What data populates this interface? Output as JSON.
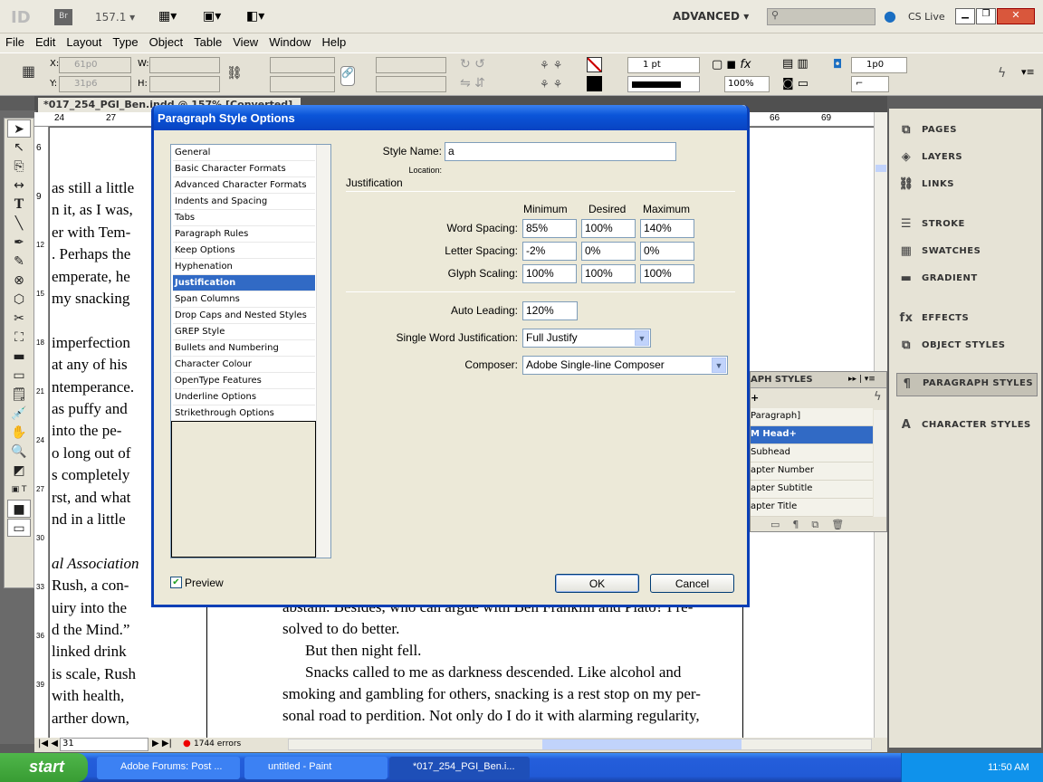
{
  "appbar": {
    "logo": "ID",
    "bridge": "Br",
    "zoom": "157.1",
    "workspace": "ADVANCED",
    "search_placeholder": "",
    "cslive": "CS Live"
  },
  "menu": [
    "File",
    "Edit",
    "Layout",
    "Type",
    "Object",
    "Table",
    "View",
    "Window",
    "Help"
  ],
  "control": {
    "x": "61p0",
    "y": "31p6",
    "w": "",
    "h": "",
    "x_label": "X:",
    "y_label": "Y:",
    "w_label": "W:",
    "h_label": "H:",
    "stroke_weight": "1 pt",
    "opacity": "100%",
    "gap": "1p0"
  },
  "document": {
    "tab_title": "*017_254_PGI_Ben.indd @ 157% [Converted]",
    "ruler_top": [
      "24",
      "27",
      "66",
      "69"
    ],
    "ruler_left": [
      "6",
      "9",
      "12",
      "15",
      "18",
      "21",
      "24",
      "27",
      "30",
      "33",
      "36",
      "39"
    ],
    "left_lines": [
      "as still a little",
      "n it, as I was,",
      "er with Tem-",
      ". Perhaps the",
      "emperate, he",
      "my snacking",
      "",
      "imperfection",
      "at any of his",
      "ntemperance.",
      "as puffy and",
      "into the pe-",
      "o long out of",
      "s completely",
      "rst, and what",
      "nd in a little",
      "",
      "al Association",
      "Rush, a con-",
      "uiry into the",
      "d the Mind.”",
      "linked drink",
      "is scale, Rush",
      "with health,",
      "arther down,"
    ],
    "right_lines": [
      "abstain. Besides, who can argue with Ben Franklin and Plato? I re-",
      "solved to do better.",
      "But then night fell.",
      "Snacks called to me as darkness descended. Like alcohol and",
      "smoking and gambling for others, snacking is a rest stop on my per-",
      "sonal road to perdition. Not only do I do it with alarming regularity,"
    ]
  },
  "status": {
    "page": "31",
    "errors": "1744 errors"
  },
  "right_panel": [
    {
      "label": "PAGES",
      "icon": "pages-icon"
    },
    {
      "label": "LAYERS",
      "icon": "layers-icon"
    },
    {
      "label": "LINKS",
      "icon": "links-icon"
    },
    {
      "label": "STROKE",
      "icon": "stroke-icon"
    },
    {
      "label": "SWATCHES",
      "icon": "swatches-icon"
    },
    {
      "label": "GRADIENT",
      "icon": "gradient-icon"
    },
    {
      "label": "EFFECTS",
      "icon": "fx-icon"
    },
    {
      "label": "OBJECT STYLES",
      "icon": "object-styles-icon"
    },
    {
      "label": "PARAGRAPH STYLES",
      "icon": "paragraph-styles-icon",
      "selected": true
    },
    {
      "label": "CHARACTER STYLES",
      "icon": "character-styles-icon"
    }
  ],
  "para_styles_panel": {
    "title": "APH STYLES",
    "current": "+",
    "items": [
      "Paragraph]",
      "M Head+",
      "Subhead",
      "apter Number",
      "apter Subtitle",
      "apter Title"
    ],
    "selected_index": 1
  },
  "dialog": {
    "title": "Paragraph Style Options",
    "categories": [
      "General",
      "Basic Character Formats",
      "Advanced Character Formats",
      "Indents and Spacing",
      "Tabs",
      "Paragraph Rules",
      "Keep Options",
      "Hyphenation",
      "Justification",
      "Span Columns",
      "Drop Caps and Nested Styles",
      "GREP Style",
      "Bullets and Numbering",
      "Character Colour",
      "OpenType Features",
      "Underline Options",
      "Strikethrough Options"
    ],
    "selected_category": 8,
    "style_name_label": "Style Name:",
    "style_name": "a",
    "location_label": "Location:",
    "section": "Justification",
    "col_headers": [
      "Minimum",
      "Desired",
      "Maximum"
    ],
    "rows": [
      {
        "label": "Word Spacing:",
        "values": [
          "85%",
          "100%",
          "140%"
        ]
      },
      {
        "label": "Letter Spacing:",
        "values": [
          "-2%",
          "0%",
          "0%"
        ]
      },
      {
        "label": "Glyph Scaling:",
        "values": [
          "100%",
          "100%",
          "100%"
        ]
      }
    ],
    "auto_leading_label": "Auto Leading:",
    "auto_leading": "120%",
    "swj_label": "Single Word Justification:",
    "swj": "Full Justify",
    "composer_label": "Composer:",
    "composer": "Adobe Single-line Composer",
    "preview_label": "Preview",
    "preview_checked": true,
    "ok": "OK",
    "cancel": "Cancel"
  },
  "taskbar": {
    "start": "start",
    "tasks": [
      "Adobe Forums: Post ...",
      "untitled - Paint",
      "*017_254_PGI_Ben.i..."
    ],
    "active_task": 2,
    "clock": "11:50 AM"
  },
  "colors": {
    "accent": "#316ac5",
    "title_bar": "#0b55d8",
    "taskbar": "#245edb"
  }
}
